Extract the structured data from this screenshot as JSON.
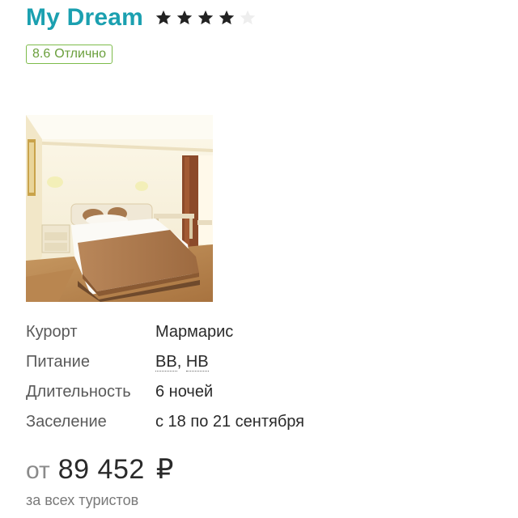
{
  "hotel": {
    "name": "My Dream",
    "stars": {
      "filled": 4,
      "total": 5
    },
    "rating": {
      "score": "8.6",
      "label": "Отлично"
    }
  },
  "photo": {
    "icon": "hotel-room-photo"
  },
  "details": {
    "resort": {
      "label": "Курорт",
      "value": "Мармарис"
    },
    "meals": {
      "label": "Питание",
      "options": [
        "BB",
        "HB"
      ],
      "separator": ", "
    },
    "duration": {
      "label": "Длительность",
      "value": "6 ночей"
    },
    "checkin": {
      "label": "Заселение",
      "value": "с 18 по 21 сентября"
    }
  },
  "price": {
    "prefix": "от",
    "amount": "89 452",
    "currency": "₽",
    "note": "за всех туристов"
  },
  "colors": {
    "brand": "#1ba0b0",
    "rating_green": "#7dbb4a",
    "star_filled": "#222222",
    "star_empty": "#eeeeee"
  }
}
